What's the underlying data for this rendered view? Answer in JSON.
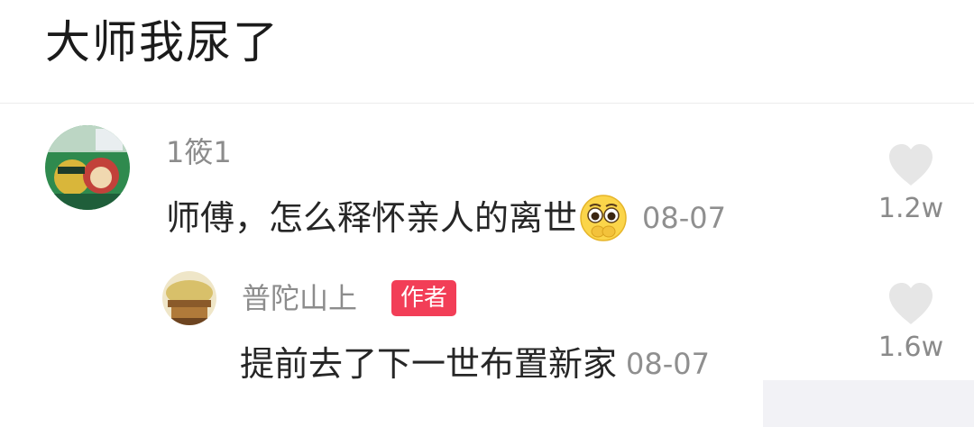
{
  "headline": "大师我尿了",
  "comments": [
    {
      "username": "1筱1",
      "text": "师傅，怎么释怀亲人的离世",
      "emoji": "pleading-face-emoji",
      "date": "08-07",
      "likes": "1.2w",
      "avatar": "cartoon-avatar"
    }
  ],
  "reply": {
    "username": "普陀山上",
    "badge": "作者",
    "text": "提前去了下一世布置新家",
    "date": "08-07",
    "likes": "1.6w",
    "avatar": "temple-avatar"
  },
  "icons": {
    "like": "heart-icon"
  },
  "colors": {
    "badge": "#f23e57",
    "heart": "#e6e6e6",
    "meta": "#8c8c8c"
  }
}
